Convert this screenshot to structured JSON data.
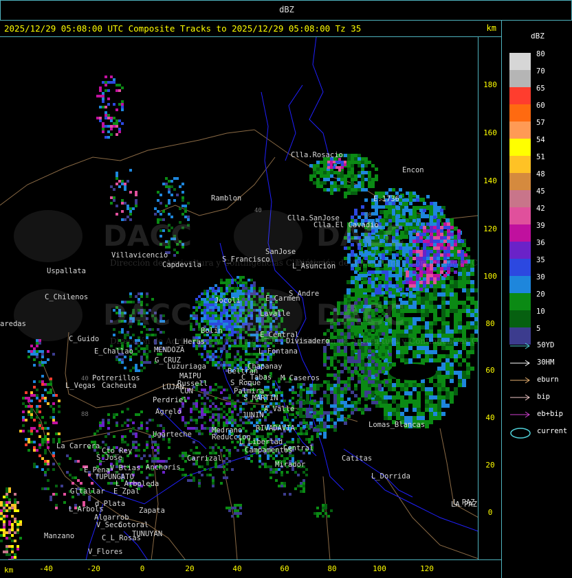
{
  "window": {
    "title": "dBZ"
  },
  "header": {
    "title": "2025/12/29 05:08:00 UTC Composite Tracks to 2025/12/29 05:08:00 Tz 35",
    "units": "km"
  },
  "axes": {
    "y_ticks": [
      "180",
      "160",
      "140",
      "120",
      "100",
      "80",
      "60",
      "40",
      "20",
      "0"
    ],
    "x_ticks": [
      "-40",
      "-20",
      "0",
      "20",
      "40",
      "60",
      "80",
      "100",
      "120"
    ],
    "x_units": "km"
  },
  "legend": {
    "title": "dBZ",
    "levels": [
      {
        "label": "80",
        "color": "#d6d6d6"
      },
      {
        "label": "70",
        "color": "#b5b5b5"
      },
      {
        "label": "65",
        "color": "#ff3d2e"
      },
      {
        "label": "60",
        "color": "#ff6a10"
      },
      {
        "label": "57",
        "color": "#ff9a55"
      },
      {
        "label": "54",
        "color": "#ffff00"
      },
      {
        "label": "51",
        "color": "#ffc225"
      },
      {
        "label": "48",
        "color": "#d58a3e"
      },
      {
        "label": "45",
        "color": "#c8758a"
      },
      {
        "label": "42",
        "color": "#e0509c"
      },
      {
        "label": "39",
        "color": "#c0109e"
      },
      {
        "label": "36",
        "color": "#6a22c8"
      },
      {
        "label": "35",
        "color": "#2c48e0"
      },
      {
        "label": "30",
        "color": "#1e86dc"
      },
      {
        "label": "20",
        "color": "#0b8a14"
      },
      {
        "label": "10",
        "color": "#066010"
      },
      {
        "label": "5",
        "color": "#3c3c8e"
      }
    ]
  },
  "tracks": [
    {
      "label": "50YD",
      "color": "#4fd0d8"
    },
    {
      "label": "30HM",
      "color": "#ffffff"
    },
    {
      "label": "eburn",
      "color": "#e6b070"
    },
    {
      "label": "bip",
      "color": "#f0c8c8"
    },
    {
      "label": "eb+bip",
      "color": "#d040d0"
    },
    {
      "label": "current",
      "color": "#4fd0d8"
    }
  ],
  "watermark": {
    "brand": "DACC",
    "text": "Dirección de Agricultura y Contingencias Climáticas"
  },
  "cities": [
    {
      "name": "Clla.Rosacio"
    },
    {
      "name": "Encon"
    },
    {
      "name": "E.1736"
    },
    {
      "name": "Ramblon"
    },
    {
      "name": "Clla.SanJose"
    },
    {
      "name": "Clla.El Cavadio"
    },
    {
      "name": "Villavicencio"
    },
    {
      "name": "Uspallata"
    },
    {
      "name": "Capdevila"
    },
    {
      "name": "S_Francisco"
    },
    {
      "name": "SanJose"
    },
    {
      "name": "L_Asuncion"
    },
    {
      "name": "Jocoli"
    },
    {
      "name": "C_Chilenos"
    },
    {
      "name": "E_Carmen"
    },
    {
      "name": "S_Andre"
    },
    {
      "name": "Lavalle"
    },
    {
      "name": "aredas"
    },
    {
      "name": "Bolin"
    },
    {
      "name": "E_Central"
    },
    {
      "name": "Divisadero"
    },
    {
      "name": "C_Guido"
    },
    {
      "name": "L_Heras"
    },
    {
      "name": "L_Fontana"
    },
    {
      "name": "E_Challao"
    },
    {
      "name": "MENDOZA"
    },
    {
      "name": "G_CRUZ"
    },
    {
      "name": "Luzuriaga"
    },
    {
      "name": "Chapanay"
    },
    {
      "name": "Beltran"
    },
    {
      "name": "C_Tabas"
    },
    {
      "name": "M_Caseros"
    },
    {
      "name": "Potrerillos"
    },
    {
      "name": "L_Vegas"
    },
    {
      "name": "Cacheuta"
    },
    {
      "name": "MAIPU"
    },
    {
      "name": "Russell"
    },
    {
      "name": "LUJAN"
    },
    {
      "name": "CUN"
    },
    {
      "name": "S_Roque"
    },
    {
      "name": "Palmira"
    },
    {
      "name": "S_MARTIN"
    },
    {
      "name": "Perdriel"
    },
    {
      "name": "A_Valle"
    },
    {
      "name": "Agrelo"
    },
    {
      "name": "JUNIN"
    },
    {
      "name": "Ugarteche"
    },
    {
      "name": "Medrano"
    },
    {
      "name": "RIVADAVIA"
    },
    {
      "name": "Reduccion"
    },
    {
      "name": "Lomas_Blancas"
    },
    {
      "name": "La Carrera"
    },
    {
      "name": "Cto_Rey"
    },
    {
      "name": "S_Jose"
    },
    {
      "name": "L_Libertad"
    },
    {
      "name": "Campamentos"
    },
    {
      "name": "Central"
    },
    {
      "name": "LA PAZ"
    },
    {
      "name": "Carrizal"
    },
    {
      "name": "Catitas"
    },
    {
      "name": "E_Pena"
    },
    {
      "name": "V_Btias"
    },
    {
      "name": "Anchoris"
    },
    {
      "name": "Mirador"
    },
    {
      "name": "TUPUNGATO"
    },
    {
      "name": "L_Dorrida"
    },
    {
      "name": "L_Arboleda"
    },
    {
      "name": "Gltallar"
    },
    {
      "name": "E_Zpal"
    },
    {
      "name": "d_Plata"
    },
    {
      "name": "L_Arbols"
    },
    {
      "name": "Zapata"
    },
    {
      "name": "L_PAZ"
    },
    {
      "name": "Algarrob"
    },
    {
      "name": "V_Seco"
    },
    {
      "name": "Cotoral"
    },
    {
      "name": "TUNUYAN"
    },
    {
      "name": "Manzano"
    },
    {
      "name": "C_L_Rosas"
    },
    {
      "name": "V_Flores"
    }
  ]
}
